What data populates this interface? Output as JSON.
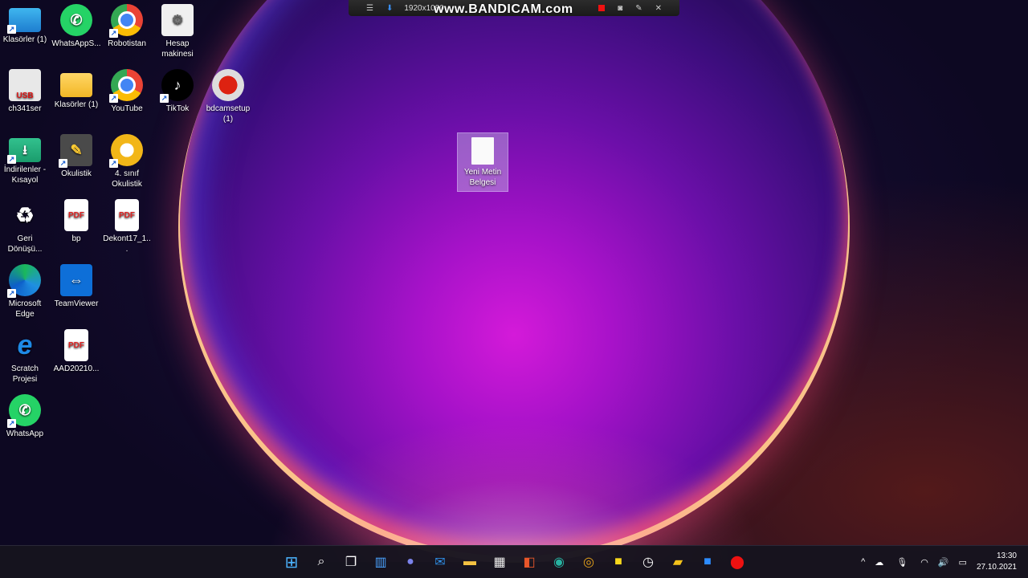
{
  "desktop": {
    "icons": [
      {
        "label": "Klasörler (1)",
        "icon": "monitor-icon"
      },
      {
        "label": "WhatsAppS...",
        "icon": "whatsapp-icon"
      },
      {
        "label": "Robotistan",
        "icon": "chrome-icon"
      },
      {
        "label": "Hesap makinesi",
        "icon": "calculator-icon"
      },
      {
        "label": "ch341ser",
        "icon": "usb-driver-icon"
      },
      {
        "label": "Klasörler (1)",
        "icon": "folder-icon"
      },
      {
        "label": "YouTube",
        "icon": "chrome-icon"
      },
      {
        "label": "TikTok",
        "icon": "tiktok-icon"
      },
      {
        "label": "bdcamsetup (1)",
        "icon": "bandicam-installer-icon"
      },
      {
        "label": "İndirilenler - Kısayol",
        "icon": "downloads-folder-icon"
      },
      {
        "label": "Okulistik",
        "icon": "okulistik-icon"
      },
      {
        "label": "4. sınıf Okulistik",
        "icon": "okulistik-chrome-icon"
      },
      {
        "label": "Geri Dönüşü...",
        "icon": "recycle-bin-icon"
      },
      {
        "label": "bp",
        "icon": "pdf-icon"
      },
      {
        "label": "Dekont17_1...",
        "icon": "pdf-icon"
      },
      {
        "label": "Microsoft Edge",
        "icon": "edge-icon"
      },
      {
        "label": "TeamViewer",
        "icon": "teamviewer-icon"
      },
      {
        "label": "Scratch Projesi",
        "icon": "internet-explorer-icon"
      },
      {
        "label": "AAD20210...",
        "icon": "pdf-icon"
      },
      {
        "label": "WhatsApp",
        "icon": "whatsapp-icon"
      },
      {
        "label": "Yeni Metin Belgesi",
        "icon": "text-document-icon",
        "selected": true
      }
    ],
    "pdf_badge": "PDF",
    "usb_badge": "USB"
  },
  "bandicam": {
    "resolution": "1920x1080",
    "watermark": "www.BANDICAM.com"
  },
  "taskbar": {
    "apps": [
      "start",
      "search",
      "task-view",
      "widgets",
      "teams-chat",
      "mail",
      "file-explorer",
      "store",
      "office",
      "edge",
      "chrome",
      "sticky-notes",
      "clock-app",
      "sticky-notes-2",
      "zoom",
      "bandicam"
    ],
    "tray": {
      "time": "13:30",
      "date": "27.10.2021"
    }
  },
  "colors": {
    "taskbar": "#16141e",
    "accent": "#d41ad9"
  }
}
